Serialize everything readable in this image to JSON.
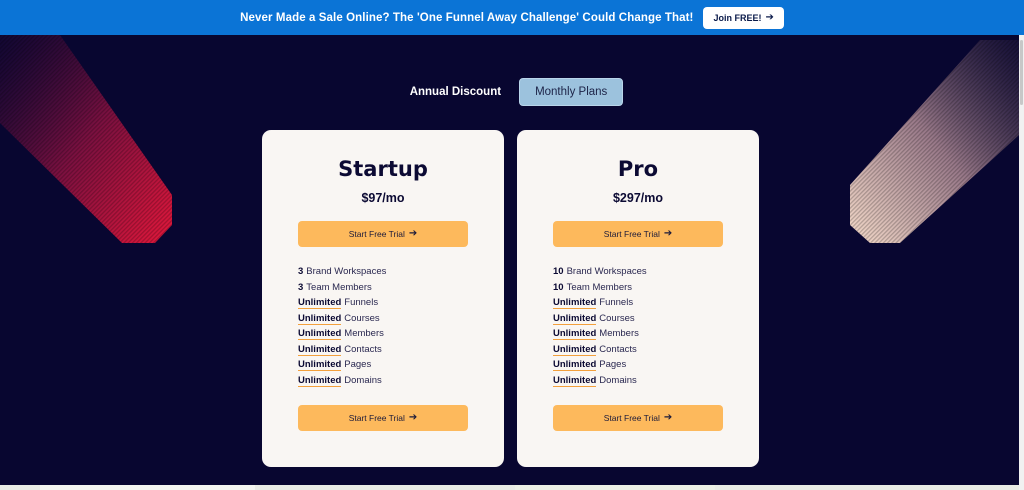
{
  "announcement": {
    "text": "Never Made a Sale Online? The 'One Funnel Away Challenge' Could Change That!",
    "button_label": "Join FREE!",
    "arrow": "➔"
  },
  "billing_toggle": {
    "annual_label": "Annual Discount",
    "monthly_label": "Monthly Plans",
    "selected": "Monthly Plans"
  },
  "plans": [
    {
      "name": "Startup",
      "price": "$97/mo",
      "cta_label": "Start Free Trial",
      "features": [
        {
          "qty": "3",
          "label": "Brand Workspaces"
        },
        {
          "qty": "3",
          "label": "Team Members"
        },
        {
          "qty": "Unlimited",
          "label": "Funnels"
        },
        {
          "qty": "Unlimited",
          "label": "Courses"
        },
        {
          "qty": "Unlimited",
          "label": "Members"
        },
        {
          "qty": "Unlimited",
          "label": "Contacts"
        },
        {
          "qty": "Unlimited",
          "label": "Pages"
        },
        {
          "qty": "Unlimited",
          "label": "Domains"
        }
      ]
    },
    {
      "name": "Pro",
      "price": "$297/mo",
      "cta_label": "Start Free Trial",
      "features": [
        {
          "qty": "10",
          "label": "Brand Workspaces"
        },
        {
          "qty": "10",
          "label": "Team Members"
        },
        {
          "qty": "Unlimited",
          "label": "Funnels"
        },
        {
          "qty": "Unlimited",
          "label": "Courses"
        },
        {
          "qty": "Unlimited",
          "label": "Members"
        },
        {
          "qty": "Unlimited",
          "label": "Contacts"
        },
        {
          "qty": "Unlimited",
          "label": "Pages"
        },
        {
          "qty": "Unlimited",
          "label": "Domains"
        }
      ]
    }
  ],
  "colors": {
    "announcement_bg": "#0b74d6",
    "page_bg": "#080630",
    "card_bg": "#f9f6f3",
    "cta_bg": "#fdb95c",
    "toggle_selected_bg": "#9cc2dd",
    "underline_accent": "#f3a03c",
    "left_beam": "#e0163a",
    "right_beam": "#f3d2c0"
  },
  "icons": {
    "arrow": "right-arrow-icon"
  }
}
